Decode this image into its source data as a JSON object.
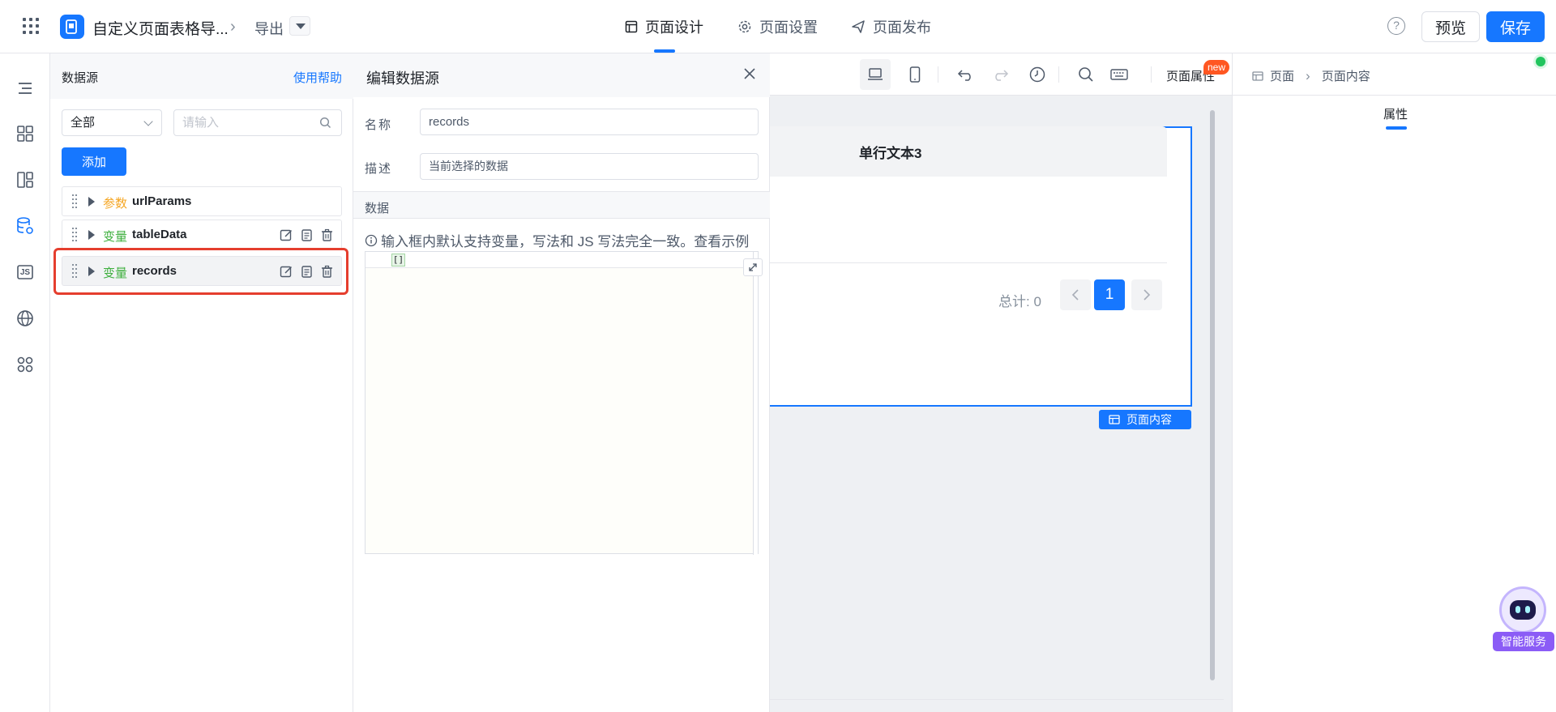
{
  "topbar": {
    "app_title": "自定义页面表格导...",
    "breadcrumb_item": "导出",
    "tabs": [
      {
        "label": "页面设计",
        "icon": "layout-icon",
        "active": true
      },
      {
        "label": "页面设置",
        "icon": "gear-icon",
        "active": false
      },
      {
        "label": "页面发布",
        "icon": "send-icon",
        "active": false
      }
    ],
    "help_glyph": "?",
    "preview_label": "预览",
    "save_label": "保存"
  },
  "rail": {
    "items": [
      "outline-icon",
      "components-icon",
      "layout-panels-icon",
      "datasource-icon",
      "js-icon",
      "globe-icon",
      "apps-grid-icon"
    ],
    "js_text": "JS"
  },
  "datasource": {
    "title": "数据源",
    "help_link": "使用帮助",
    "filter_value": "全部",
    "search_placeholder": "请输入",
    "add_label": "添加",
    "items": [
      {
        "kind": "参数",
        "name": "urlParams",
        "kind_type": "param"
      },
      {
        "kind": "变量",
        "name": "tableData",
        "kind_type": "var"
      },
      {
        "kind": "变量",
        "name": "records",
        "kind_type": "var",
        "selected": true
      }
    ]
  },
  "editor": {
    "title": "编辑数据源",
    "name_label": "名称",
    "name_value": "records",
    "desc_label": "描述",
    "desc_value": "当前选择的数据",
    "data_section": "数据",
    "info_text": "输入框内默认支持变量，写法和 JS 写法完全一致。查看示例",
    "code_value": "[]"
  },
  "canvas": {
    "page_attr_label": "页面属性",
    "new_badge": "new",
    "column_header": "单行文本3",
    "total_text": "总计: 0",
    "current_page": "1",
    "page_tag": "页面内容"
  },
  "props": {
    "breadcrumb": [
      "页面",
      "页面内容"
    ],
    "tab_label": "属性"
  },
  "assistant": {
    "label": "智能服务"
  }
}
